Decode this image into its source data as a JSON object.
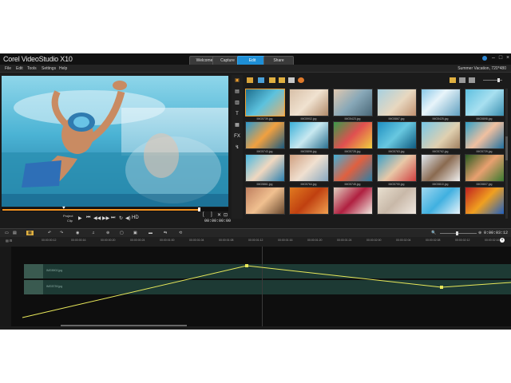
{
  "app": {
    "title": "Corel VideoStudio X10",
    "tabs": [
      "Welcome",
      "Capture",
      "Edit",
      "Share"
    ],
    "active_tab": "Edit",
    "window_controls": [
      "–",
      "□",
      "×"
    ]
  },
  "menu": {
    "items": [
      "File",
      "Edit",
      "Tools",
      "Settings",
      "Help"
    ]
  },
  "project_name": "Summer Vacation, 720*480",
  "preview": {
    "mode_labels": [
      "Project",
      "Clip"
    ],
    "timecode": "00:00:00:00",
    "progress": 0.87
  },
  "library": {
    "files": [
      "IMG5739.jpg",
      "IMG5902.jpg",
      "IMG5423.jpg",
      "IMG5867.jpg",
      "IMG5425.jpg",
      "IMG5898.jpg",
      "IMG5743.jpg",
      "IMG5896.jpg",
      "IMG5728.jpg",
      "IMG5763.jpg",
      "IMG5762.jpg",
      "IMG5729.jpg",
      "IMG5861.jpg",
      "IMG5764.jpg",
      "IMG5745.jpg",
      "IMG5790.jpg",
      "IMG5810.jpg",
      "IMG5807.jpg",
      "",
      "",
      "",
      "",
      "",
      ""
    ]
  },
  "timeline": {
    "total_time": "0:00:03:12",
    "ruler_ticks": [
      "00:00:00:12",
      "00:00:00:16",
      "00:00:00:20",
      "00:00:00:24",
      "00:00:01:00",
      "00:00:01:04",
      "00:00:01:08",
      "00:00:01:12",
      "00:00:01:16",
      "00:00:01:20",
      "00:00:01:24",
      "00:00:02:00",
      "00:00:02:04",
      "00:00:02:08",
      "00:00:02:12",
      "00:00:02:16",
      "00:00:02:20"
    ],
    "clips": [
      "IMG5902.jpg",
      "IMG5739.jpg"
    ]
  },
  "colors": {
    "accent": "#1e8fd6",
    "orange": "#f29220",
    "keyframe_line": "#e8e85a"
  }
}
